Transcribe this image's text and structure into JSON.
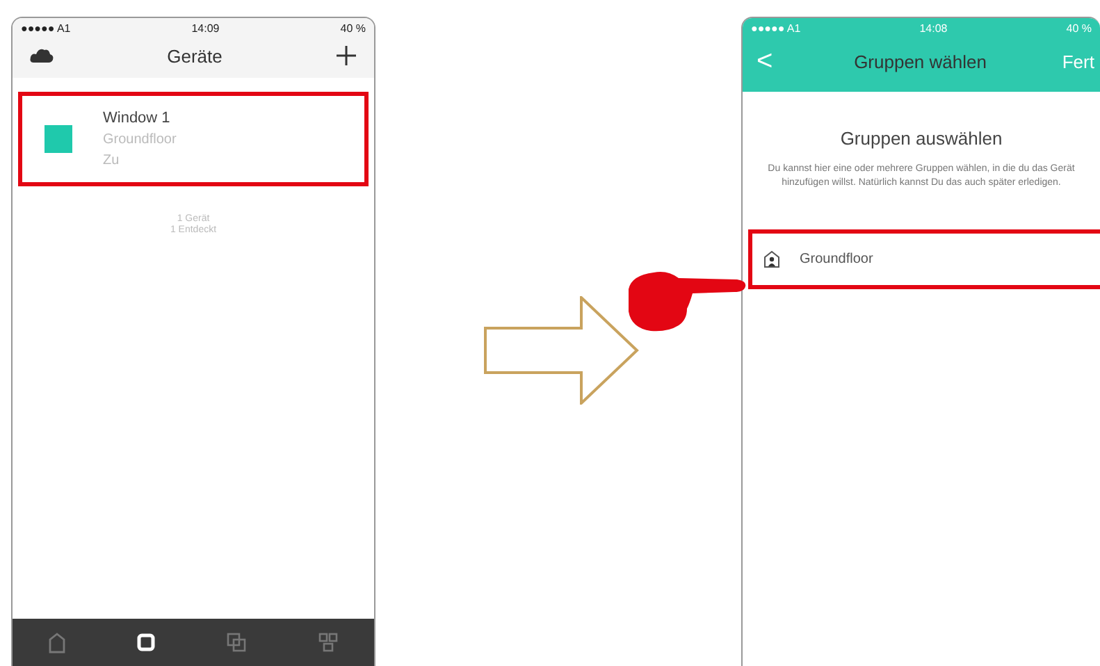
{
  "left_phone": {
    "status_bar": {
      "carrier": "●●●●● A1",
      "time": "14:09",
      "battery": "40 %"
    },
    "nav": {
      "title": "Geräte"
    },
    "devices": [
      {
        "name": "Window 1",
        "group": "Groundfloor",
        "state": "Zu",
        "color": "#1fc9ac",
        "highlighted": true
      }
    ],
    "summary": [
      "1 Gerät",
      "1 Entdeckt"
    ],
    "tab_bar": [
      {
        "kind": "home",
        "selected": false
      },
      {
        "kind": "device",
        "selected": true
      },
      {
        "kind": "scenes",
        "selected": false
      },
      {
        "kind": "groups",
        "selected": false
      }
    ]
  },
  "right_phone": {
    "status_bar": {
      "carrier": "●●●●● A1",
      "time": "14:08",
      "battery": "40 %"
    },
    "nav": {
      "back": "<",
      "title": "Gruppen wählen",
      "action": "Fert"
    },
    "heading": "Gruppen auswählen",
    "description": "Du kannst hier eine oder mehrere Gruppen wählen, in die du das Gerät hinzufügen willst. Natürlich kannst Du das auch später erledigen.",
    "groups": [
      {
        "name": "Groundfloor",
        "highlighted": true
      }
    ]
  }
}
